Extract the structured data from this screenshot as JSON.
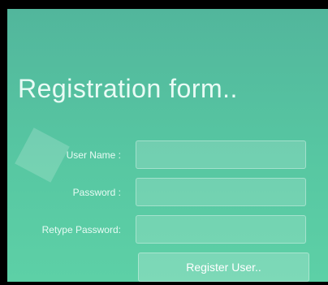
{
  "form": {
    "title": "Registration form..",
    "fields": [
      {
        "label": "User Name :",
        "value": "",
        "placeholder": ""
      },
      {
        "label": "Password :",
        "value": "",
        "placeholder": ""
      },
      {
        "label": "Retype Password:",
        "value": "",
        "placeholder": ""
      }
    ],
    "submit_label": "Register User.."
  },
  "colors": {
    "background_top": "#52b69c",
    "background_bottom": "#5dd0a6",
    "frame": "#000000",
    "text": "#ffffff"
  }
}
